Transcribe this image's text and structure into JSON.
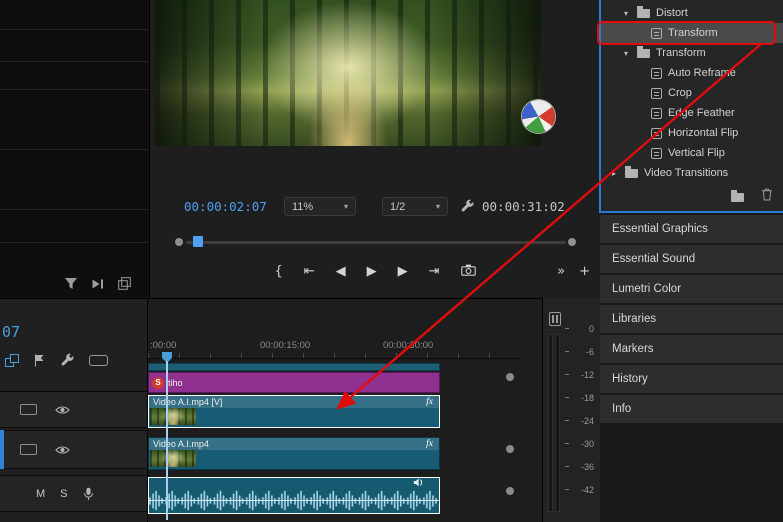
{
  "monitor": {
    "current_timecode": "00:00:02:07",
    "zoom_level": "11%",
    "playback_resolution": "1/2",
    "duration": "00:00:31:02"
  },
  "icons": {
    "chevron_down": "▾",
    "tree_open": "▾",
    "tree_closed": "▸",
    "marker_brace": "{",
    "go_to_in": "⇤",
    "step_back": "◀",
    "play": "▶",
    "step_forward": "▶",
    "go_to_out": "⇥",
    "overflow": "»",
    "add": "+"
  },
  "effects_panel": {
    "rows": [
      {
        "label": "Distort",
        "kind": "folder",
        "depth": 1,
        "expanded": true,
        "highlighted": false
      },
      {
        "label": "Transform",
        "kind": "effect",
        "depth": 2,
        "highlighted": true
      },
      {
        "label": "Transform",
        "kind": "folder",
        "depth": 1,
        "expanded": true,
        "highlighted": false
      },
      {
        "label": "Auto Reframe",
        "kind": "effect",
        "depth": 2,
        "highlighted": false
      },
      {
        "label": "Crop",
        "kind": "effect",
        "depth": 2,
        "highlighted": false
      },
      {
        "label": "Edge Feather",
        "kind": "effect",
        "depth": 2,
        "highlighted": false
      },
      {
        "label": "Horizontal Flip",
        "kind": "effect",
        "depth": 2,
        "highlighted": false
      },
      {
        "label": "Vertical Flip",
        "kind": "effect",
        "depth": 2,
        "highlighted": false
      },
      {
        "label": "Video Transitions",
        "kind": "folder",
        "depth": 0,
        "expanded": false,
        "highlighted": false
      }
    ]
  },
  "panel_tabs": [
    "Essential Graphics",
    "Essential Sound",
    "Lumetri Color",
    "Libraries",
    "Markers",
    "History",
    "Info"
  ],
  "timeline": {
    "timecode_fragment": "07",
    "ruler_labels": [
      ":00:00",
      "00:00:15:00",
      "00:00:30:00"
    ],
    "graphic_clip_badge": "S",
    "graphic_clip_label": "tiho",
    "video_clips": [
      {
        "name": "Video A.I.mp4 [V]",
        "fx_badge": "fx"
      },
      {
        "name": "Video A.I.mp4",
        "fx_badge": "fx"
      }
    ],
    "audio_track": {
      "mute": "M",
      "solo": "S"
    }
  },
  "audio_meter": {
    "scale": [
      "0",
      "-6",
      "-12",
      "-18",
      "-24",
      "-30",
      "-36",
      "-42"
    ]
  },
  "colors": {
    "annotation_red": "#e30b0b",
    "focus_blue": "#2b7cd3",
    "timecode_blue": "#4f9ff5",
    "clip_teal": "#175b74",
    "clip_purple": "#90308f"
  }
}
